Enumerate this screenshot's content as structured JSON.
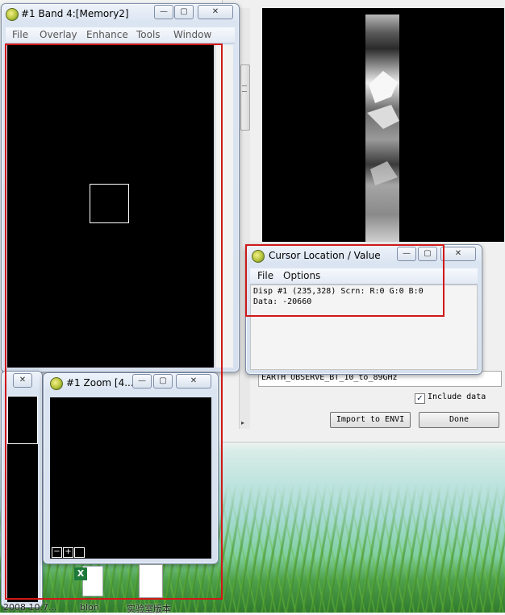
{
  "band_window": {
    "title": "#1 Band 4:[Memory2]",
    "menu": [
      "File",
      "Overlay",
      "Enhance",
      "Tools",
      "Window"
    ]
  },
  "cursor_window": {
    "title": "Cursor Location / Value",
    "menu": [
      "File",
      "Options"
    ],
    "line1": "Disp #1 (235,328) Scrn: R:0 G:0 B:0",
    "line2": "Data: -20660"
  },
  "zoom_window": {
    "title": "#1 Zoom [4..."
  },
  "import_panel": {
    "filename_field": "EARTH_OBSERVE_BT_10_to_89GHz",
    "include_data_label": "Include data",
    "include_data_checked": true,
    "import_button": "Import to ENVI",
    "done_button": "Done"
  },
  "desktop": {
    "icons": [
      {
        "label": "2008 10.7...",
        "icon": "file-icon"
      },
      {
        "label": "blon",
        "icon": "excel-file-icon"
      },
      {
        "label": "实验室版本",
        "icon": "document-icon"
      }
    ]
  },
  "colors": {
    "highlight_red": "#d01818",
    "image_background": "#000000"
  }
}
